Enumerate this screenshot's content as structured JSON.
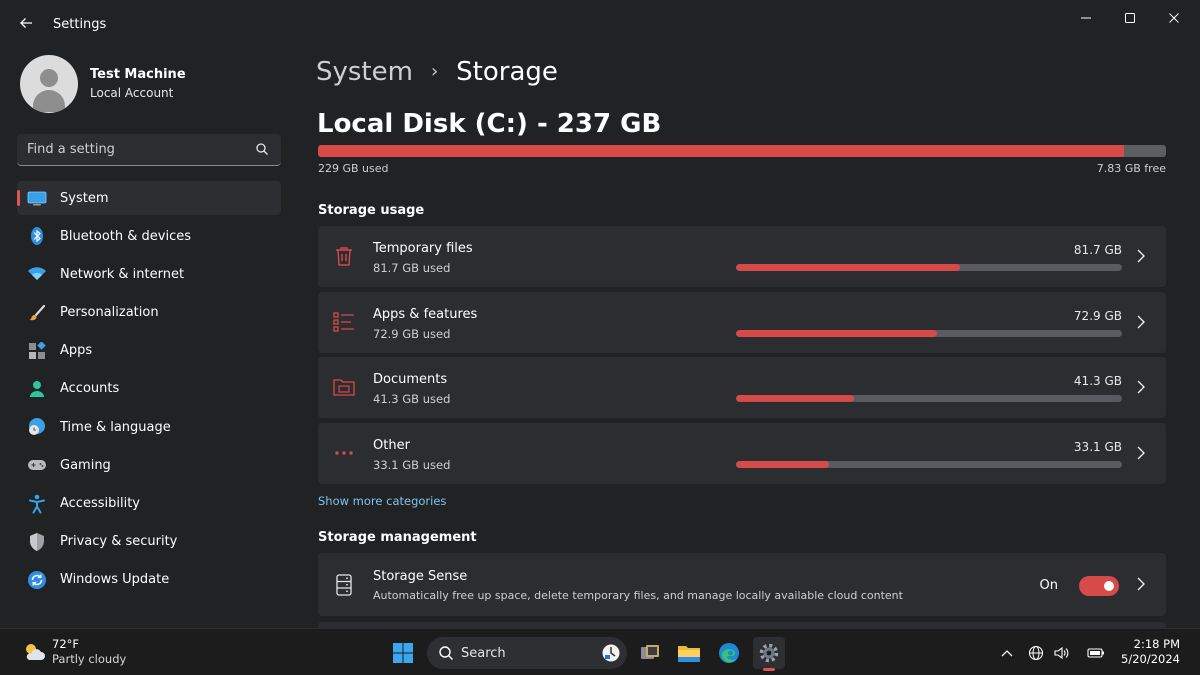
{
  "window": {
    "app_title": "Settings"
  },
  "profile": {
    "name": "Test Machine",
    "account_type": "Local Account"
  },
  "search": {
    "placeholder": "Find a setting"
  },
  "nav": {
    "active": "System",
    "items": [
      {
        "label": "System",
        "icon": "monitor-icon"
      },
      {
        "label": "Bluetooth & devices",
        "icon": "bluetooth-icon"
      },
      {
        "label": "Network & internet",
        "icon": "wifi-icon"
      },
      {
        "label": "Personalization",
        "icon": "brush-icon"
      },
      {
        "label": "Apps",
        "icon": "apps-icon"
      },
      {
        "label": "Accounts",
        "icon": "person-icon"
      },
      {
        "label": "Time & language",
        "icon": "globe-clock-icon"
      },
      {
        "label": "Gaming",
        "icon": "gamepad-icon"
      },
      {
        "label": "Accessibility",
        "icon": "accessibility-icon"
      },
      {
        "label": "Privacy & security",
        "icon": "shield-icon"
      },
      {
        "label": "Windows Update",
        "icon": "refresh-icon"
      }
    ]
  },
  "breadcrumb": {
    "parent": "System",
    "separator": "›",
    "current": "Storage"
  },
  "disk": {
    "title": "Local Disk (C:) - 237 GB",
    "used_label": "229 GB used",
    "free_label": "7.83 GB free",
    "used_fraction": 0.951
  },
  "storage_usage": {
    "title": "Storage usage",
    "categories": [
      {
        "name": "Temporary files",
        "used": "81.7 GB used",
        "size": "81.7 GB",
        "fraction": 0.58,
        "icon": "trash-icon"
      },
      {
        "name": "Apps & features",
        "used": "72.9 GB used",
        "size": "72.9 GB",
        "fraction": 0.52,
        "icon": "list-icon"
      },
      {
        "name": "Documents",
        "used": "41.3 GB used",
        "size": "41.3 GB",
        "fraction": 0.305,
        "icon": "folder-icon"
      },
      {
        "name": "Other",
        "used": "33.1 GB used",
        "size": "33.1 GB",
        "fraction": 0.24,
        "icon": "more-icon"
      }
    ],
    "show_more": "Show more categories"
  },
  "storage_management": {
    "title": "Storage management",
    "storage_sense": {
      "name": "Storage Sense",
      "description": "Automatically free up space, delete temporary files, and manage locally available cloud content",
      "state": "On",
      "enabled": true
    }
  },
  "taskbar": {
    "weather": {
      "temp": "72°F",
      "condition": "Partly cloudy"
    },
    "search_placeholder": "Search",
    "time": "2:18 PM",
    "date": "5/20/2024"
  },
  "colors": {
    "accent": "#d64a4a",
    "link": "#7fc4ec",
    "window_bg": "#202224",
    "card_bg": "#2b2d30"
  }
}
